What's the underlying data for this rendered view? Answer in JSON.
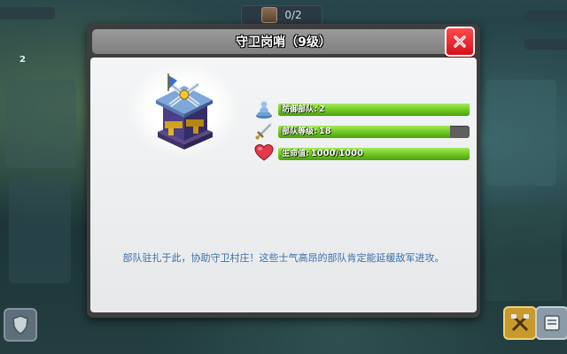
{
  "hud": {
    "top_counter": "0/2",
    "left_counter": "2"
  },
  "modal": {
    "title": "守卫岗哨（9级）",
    "close_label": "X",
    "description": "部队驻扎于此，协助守卫村庄！这些士气高昂的部队肯定能延缓敌军进攻。",
    "stats": [
      {
        "label": "防御部队:",
        "value": "2",
        "fill": 1.0,
        "icon": "troop-statue-icon"
      },
      {
        "label": "部队等级:",
        "value": "18",
        "fill": 0.9,
        "icon": "sword-icon"
      },
      {
        "label": "生命值:",
        "value": "1000/1000",
        "fill": 1.0,
        "icon": "heart-icon"
      }
    ]
  },
  "colors": {
    "bar_fill": "#6bc61e",
    "bar_track": "#5f5f5f",
    "close_button": "#e01b24",
    "description_text": "#3d6fa8"
  }
}
